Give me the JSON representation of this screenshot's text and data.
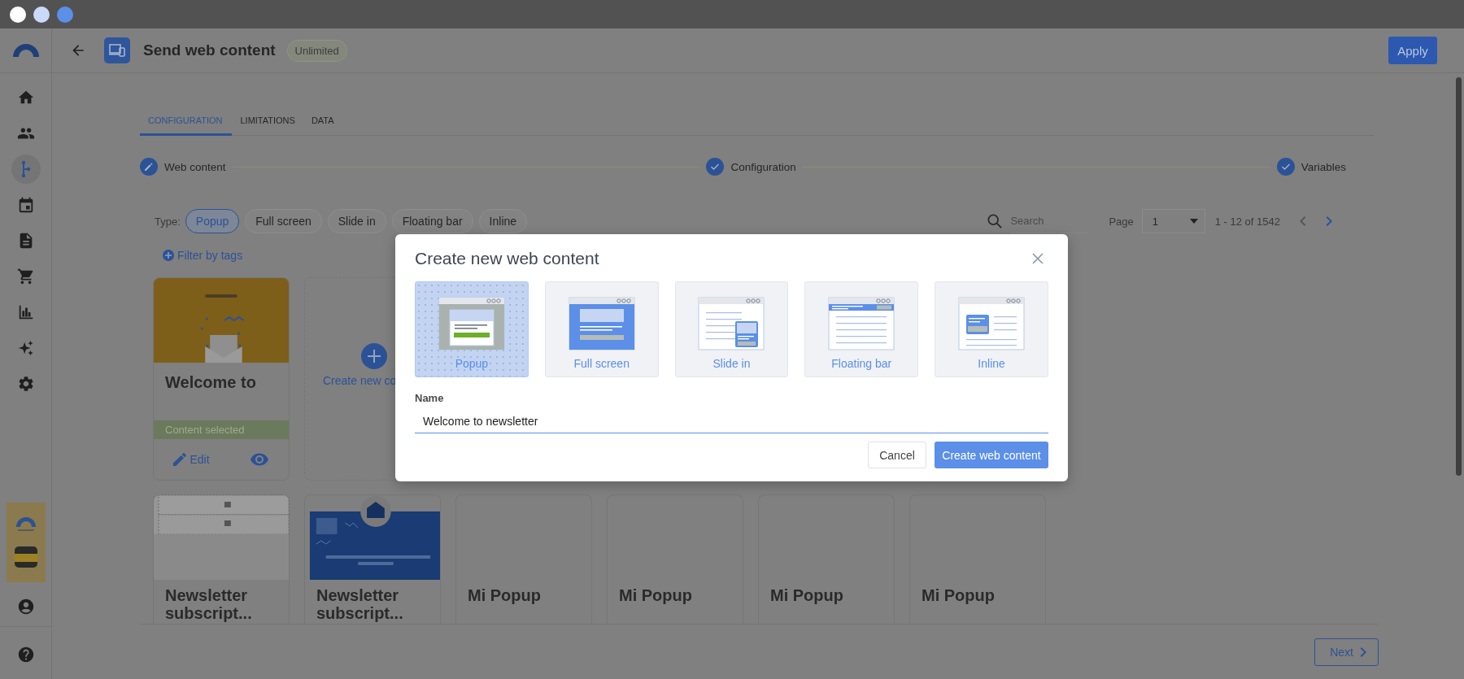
{
  "window": {
    "controls": [
      {
        "color": "#ffffff"
      },
      {
        "color": "#c9d9f7"
      },
      {
        "color": "#5b8fe8"
      }
    ]
  },
  "sidebar": {
    "items": [
      {
        "kind": "home",
        "selected": false
      },
      {
        "kind": "people",
        "selected": false
      },
      {
        "kind": "flow",
        "selected": true
      },
      {
        "kind": "calendar",
        "selected": false
      },
      {
        "kind": "document",
        "selected": false
      },
      {
        "kind": "cart",
        "selected": false
      },
      {
        "kind": "chart",
        "selected": false
      },
      {
        "kind": "sparkles",
        "selected": false
      },
      {
        "kind": "gear",
        "selected": false
      }
    ],
    "bottom_items": [
      {
        "kind": "picture"
      },
      {
        "kind": "user"
      },
      {
        "kind": "help"
      }
    ]
  },
  "header": {
    "title": "Send web content",
    "badge": "Unlimited",
    "apply": "Apply"
  },
  "tabs": [
    {
      "label": "CONFIGURATION",
      "selected": true
    },
    {
      "label": "LIMITATIONS",
      "selected": false
    },
    {
      "label": "DATA",
      "selected": false
    }
  ],
  "steps": [
    {
      "label": "Web content",
      "current": true
    },
    {
      "label": "Configuration",
      "current": false
    },
    {
      "label": "Variables",
      "current": false
    }
  ],
  "filters": {
    "type_label": "Type:",
    "chips": [
      {
        "label": "Popup",
        "selected": true
      },
      {
        "label": "Full screen",
        "selected": false
      },
      {
        "label": "Slide in",
        "selected": false
      },
      {
        "label": "Floating bar",
        "selected": false
      },
      {
        "label": "Inline",
        "selected": false
      }
    ],
    "search": {
      "placeholder": "Search"
    },
    "page_label": "Page",
    "page": "1",
    "range": "1 - 12 of 1542",
    "prev": {
      "disabled": true
    },
    "next": {
      "disabled": false
    },
    "filter_by_tags": "Filter by tags"
  },
  "cards_row_1": [
    {
      "kind": "content",
      "title": "Welcome to",
      "thumbnail": {
        "kind": "picture"
      },
      "status": "Content selected",
      "edit": "Edit"
    },
    {
      "kind": "create",
      "label": "Create new co"
    }
  ],
  "cards_row_2": [
    {
      "kind": "content",
      "title": "Newsletter subscript...",
      "thumbnail": {
        "kind": "picture"
      }
    },
    {
      "kind": "content",
      "title": "Newsletter subscript...",
      "thumbnail": {
        "kind": "picture"
      }
    },
    {
      "kind": "content",
      "title": "Mi Popup"
    },
    {
      "kind": "content",
      "title": "Mi Popup"
    },
    {
      "kind": "content",
      "title": "Mi Popup"
    },
    {
      "kind": "content",
      "title": "Mi Popup"
    }
  ],
  "footer": {
    "next": "Next"
  },
  "modal": {
    "title": "Create new web content",
    "types": [
      {
        "kind": "popup",
        "label": "Popup",
        "selected": true
      },
      {
        "kind": "fullscreen",
        "label": "Full screen",
        "selected": false
      },
      {
        "kind": "slidein",
        "label": "Slide in",
        "selected": false
      },
      {
        "kind": "floatingbar",
        "label": "Floating bar",
        "selected": false
      },
      {
        "kind": "inline",
        "label": "Inline",
        "selected": false
      }
    ],
    "name_label": "Name",
    "name_value": "Welcome to newsletter",
    "cancel": "Cancel",
    "submit": "Create web content"
  }
}
